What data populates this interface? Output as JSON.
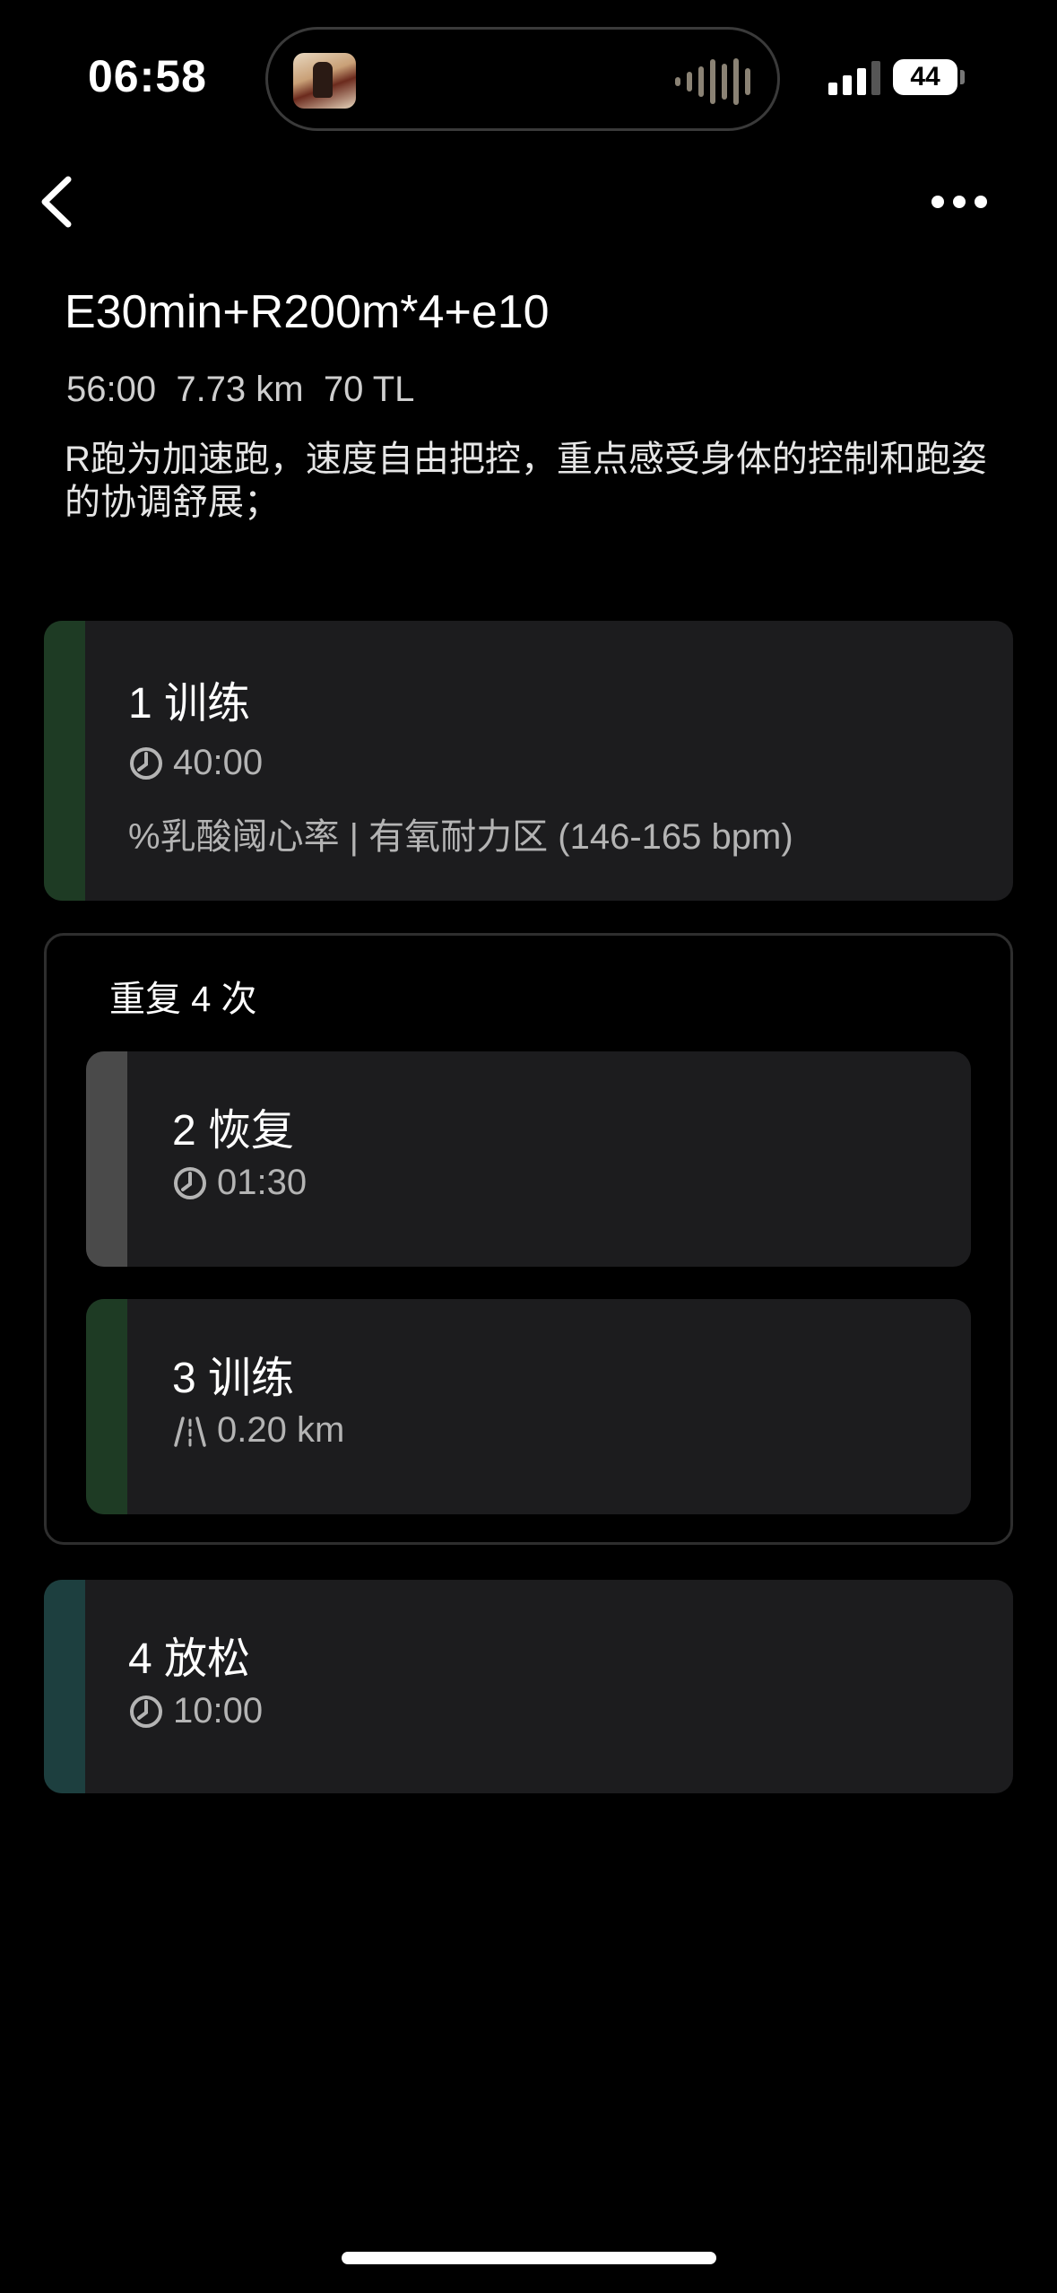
{
  "status_bar": {
    "time": "06:58",
    "battery": "44"
  },
  "header": {
    "title": "E30min+R200m*4+e10",
    "stats": "56:00  7.73 km  70 TL",
    "description": "R跑为加速跑，速度自由把控，重点感受身体的控制和跑姿的协调舒展；"
  },
  "steps": {
    "s1": {
      "title": "1 训练",
      "duration": "40:00",
      "zone": "%乳酸阈心率 | 有氧耐力区 (146-165 bpm)",
      "bar_color": "#1e3b24"
    },
    "repeat": {
      "label": "重复 4 次"
    },
    "s2": {
      "title": "2 恢复",
      "duration": "01:30",
      "bar_color": "#4a4a4a"
    },
    "s3": {
      "title": "3 训练",
      "distance": "0.20 km",
      "bar_color": "#1e3b24"
    },
    "s4": {
      "title": "4 放松",
      "duration": "10:00",
      "bar_color": "#1d3f3f"
    }
  },
  "icons": {
    "back": "chevron-left-icon",
    "more": "more-horizontal-icon",
    "clock": "clock-icon",
    "road": "road-icon"
  }
}
